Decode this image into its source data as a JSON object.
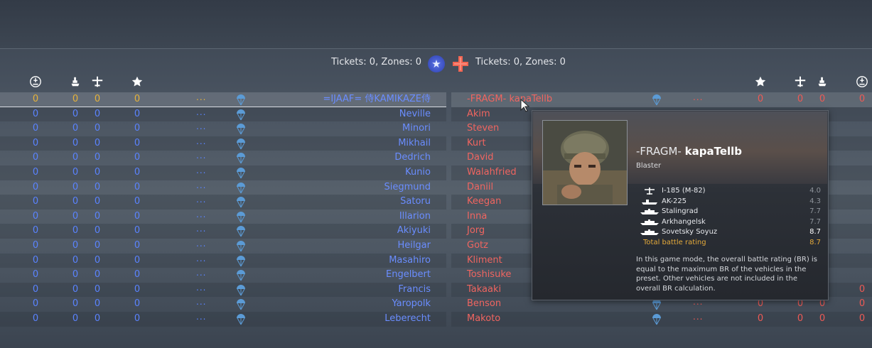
{
  "header": {
    "left_tickets": "Tickets: 0, Zones: 0",
    "right_tickets": "Tickets: 0, Zones: 0"
  },
  "colors": {
    "ally_blue": "#5a83ff",
    "enemy_red": "#ee5a55",
    "self_yellow": "#e6b33a",
    "total_orange": "#e3a93a"
  },
  "columns_icons": [
    "lives-icon",
    "ship-icon",
    "plane-icon",
    "star-icon"
  ],
  "allies": [
    {
      "name": "=IJAAF= 侍KAMIKAZE侍",
      "s1": "0",
      "s2": "0",
      "s3": "0",
      "s4": "0",
      "dots": "...",
      "self": true
    },
    {
      "name": "Neville",
      "s1": "0",
      "s2": "0",
      "s3": "0",
      "s4": "0",
      "dots": "..."
    },
    {
      "name": "Minori",
      "s1": "0",
      "s2": "0",
      "s3": "0",
      "s4": "0",
      "dots": "..."
    },
    {
      "name": "Mikhail",
      "s1": "0",
      "s2": "0",
      "s3": "0",
      "s4": "0",
      "dots": "..."
    },
    {
      "name": "Dedrich",
      "s1": "0",
      "s2": "0",
      "s3": "0",
      "s4": "0",
      "dots": "..."
    },
    {
      "name": "Kunio",
      "s1": "0",
      "s2": "0",
      "s3": "0",
      "s4": "0",
      "dots": "..."
    },
    {
      "name": "Siegmund",
      "s1": "0",
      "s2": "0",
      "s3": "0",
      "s4": "0",
      "dots": "..."
    },
    {
      "name": "Satoru",
      "s1": "0",
      "s2": "0",
      "s3": "0",
      "s4": "0",
      "dots": "..."
    },
    {
      "name": "Illarion",
      "s1": "0",
      "s2": "0",
      "s3": "0",
      "s4": "0",
      "dots": "..."
    },
    {
      "name": "Akiyuki",
      "s1": "0",
      "s2": "0",
      "s3": "0",
      "s4": "0",
      "dots": "..."
    },
    {
      "name": "Heilgar",
      "s1": "0",
      "s2": "0",
      "s3": "0",
      "s4": "0",
      "dots": "..."
    },
    {
      "name": "Masahiro",
      "s1": "0",
      "s2": "0",
      "s3": "0",
      "s4": "0",
      "dots": "..."
    },
    {
      "name": "Engelbert",
      "s1": "0",
      "s2": "0",
      "s3": "0",
      "s4": "0",
      "dots": "..."
    },
    {
      "name": "Francis",
      "s1": "0",
      "s2": "0",
      "s3": "0",
      "s4": "0",
      "dots": "..."
    },
    {
      "name": "Yaropolk",
      "s1": "0",
      "s2": "0",
      "s3": "0",
      "s4": "0",
      "dots": "..."
    },
    {
      "name": "Leberecht",
      "s1": "0",
      "s2": "0",
      "s3": "0",
      "s4": "0",
      "dots": "..."
    }
  ],
  "enemies": [
    {
      "name": "-FRAGM- kapaTellb",
      "s1": "0",
      "s2": "0",
      "s3": "0",
      "s4": "0",
      "dots": "...",
      "hovered": true
    },
    {
      "name": "Akim"
    },
    {
      "name": "Steven"
    },
    {
      "name": "Kurt"
    },
    {
      "name": "David"
    },
    {
      "name": "Walahfried"
    },
    {
      "name": "Daniil"
    },
    {
      "name": "Keegan"
    },
    {
      "name": "Inna"
    },
    {
      "name": "Jorg"
    },
    {
      "name": "Gotz"
    },
    {
      "name": "Kliment"
    },
    {
      "name": "Toshisuke"
    },
    {
      "name": "Takaaki",
      "s1": "0",
      "s2": "0",
      "s3": "0",
      "s4": "0",
      "dots": "..."
    },
    {
      "name": "Benson",
      "s1": "0",
      "s2": "0",
      "s3": "0",
      "s4": "0",
      "dots": "..."
    },
    {
      "name": "Makoto",
      "s1": "0",
      "s2": "0",
      "s3": "0",
      "s4": "0",
      "dots": "..."
    }
  ],
  "tooltip": {
    "clan_tag": "-FRAGM-",
    "player_name": "kapaTellb",
    "player_title": "Blaster",
    "vehicles": [
      {
        "icon": "plane-icon",
        "name": "I-185 (M-82)",
        "br": "4.0"
      },
      {
        "icon": "boat-icon",
        "name": "AK-225",
        "br": "4.3"
      },
      {
        "icon": "ship-icon",
        "name": "Stalingrad",
        "br": "7.7"
      },
      {
        "icon": "ship-icon",
        "name": "Arkhangelsk",
        "br": "7.7"
      },
      {
        "icon": "ship-icon",
        "name": "Sovetsky Soyuz",
        "br": "8.7"
      }
    ],
    "total_label": "Total battle rating",
    "total_br": "8.7",
    "note": "In this game mode, the overall battle rating (BR) is equal to the maximum BR of the vehicles in the preset. Other vehicles are not included in the overall BR calculation."
  }
}
